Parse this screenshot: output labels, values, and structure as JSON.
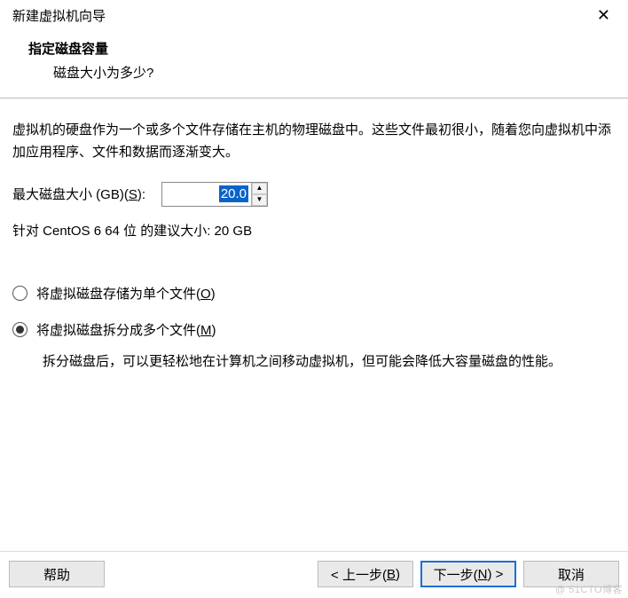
{
  "titlebar": {
    "title": "新建虚拟机向导"
  },
  "header": {
    "title": "指定磁盘容量",
    "subtitle": "磁盘大小为多少?"
  },
  "content": {
    "description": "虚拟机的硬盘作为一个或多个文件存储在主机的物理磁盘中。这些文件最初很小，随着您向虚拟机中添加应用程序、文件和数据而逐渐变大。",
    "size_label_prefix": "最大磁盘大小 (GB)(",
    "size_label_key": "S",
    "size_label_suffix": "):",
    "size_value": "20.0",
    "recommended": "针对 CentOS 6 64 位 的建议大小: 20 GB",
    "radio_single_prefix": "将虚拟磁盘存储为单个文件(",
    "radio_single_key": "O",
    "radio_single_suffix": ")",
    "radio_split_prefix": "将虚拟磁盘拆分成多个文件(",
    "radio_split_key": "M",
    "radio_split_suffix": ")",
    "split_desc": "拆分磁盘后，可以更轻松地在计算机之间移动虚拟机，但可能会降低大容量磁盘的性能。"
  },
  "buttons": {
    "help": "帮助",
    "back_prefix": "< 上一步(",
    "back_key": "B",
    "back_suffix": ")",
    "next_prefix": "下一步(",
    "next_key": "N",
    "next_suffix": ") >",
    "cancel": "取消"
  },
  "watermark": "@ 51CTO博客"
}
